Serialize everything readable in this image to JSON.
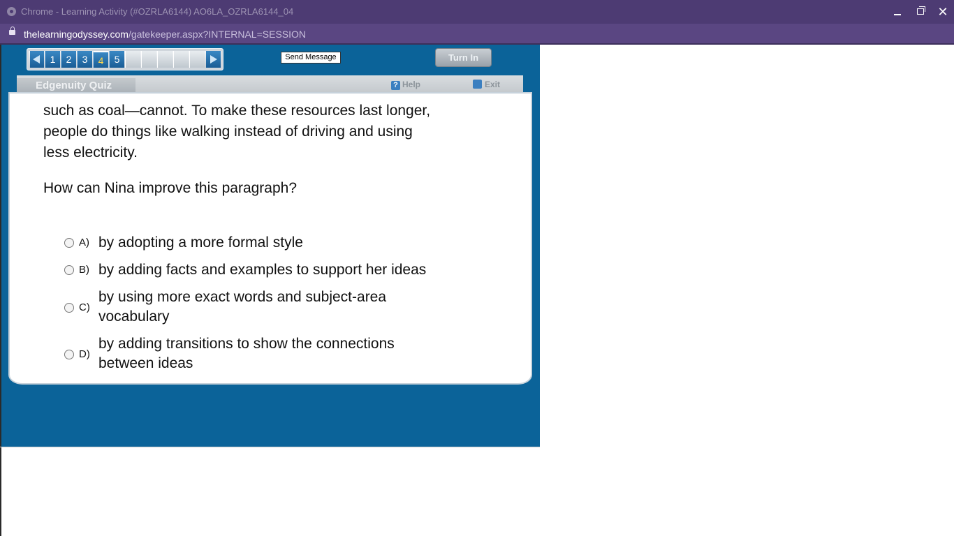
{
  "window": {
    "title": "Chrome - Learning Activity (#OZRLA6144) AO6LA_OZRLA6144_04",
    "minimize": "",
    "maximize": "",
    "close": "✕"
  },
  "address": {
    "host": "thelearningodyssey.com",
    "path": "/gatekeeper.aspx?INTERNAL=SESSION"
  },
  "nav": {
    "pages": [
      "1",
      "2",
      "3",
      "4",
      "5"
    ],
    "current": "4"
  },
  "toolbar": {
    "send_message": "Send Message",
    "turn_in": "Turn In"
  },
  "quiz": {
    "title": "Edgenuity Quiz",
    "help": "Help",
    "help_glyph": "?",
    "exit": "Exit",
    "passage_lines": [
      "such as coal—cannot. To make these resources last longer,",
      "people do things like walking instead of driving and using",
      "less electricity."
    ],
    "question": "How can Nina improve this paragraph?",
    "options": [
      {
        "letter": "A)",
        "text": "by adopting a more formal style"
      },
      {
        "letter": "B)",
        "text": "by adding facts and examples to support her ideas"
      },
      {
        "letter": "C)",
        "text": "by using more exact words and subject-area vocabulary"
      },
      {
        "letter": "D)",
        "text": "by adding transitions to show the connections between ideas"
      }
    ]
  }
}
